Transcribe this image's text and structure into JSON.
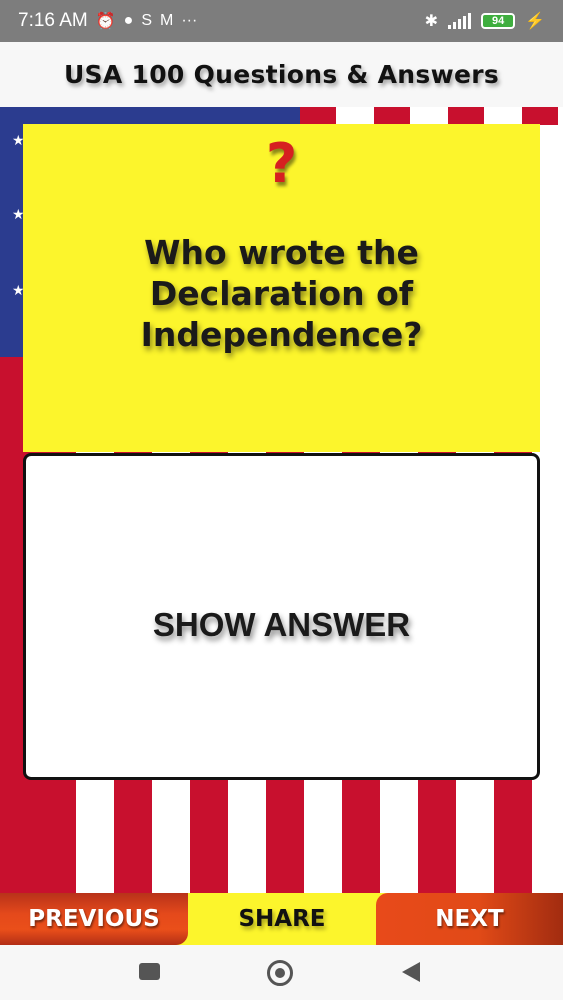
{
  "status_bar": {
    "time": "7:16 AM",
    "icons_left": [
      "alarm-icon",
      "chat-bubble-icon",
      "s-app-icon",
      "mail-icon",
      "more-dots-icon"
    ],
    "icons_right": [
      "bluetooth-icon",
      "signal-icon",
      "battery-icon",
      "charging-icon"
    ],
    "battery": "94",
    "more": "···"
  },
  "header": {
    "title": "USA 100 Questions & Answers"
  },
  "question": {
    "icon": "?",
    "text": "Who wrote the Declaration of Independence?"
  },
  "answer": {
    "label": "SHOW ANSWER"
  },
  "buttons": {
    "previous": "PREVIOUS",
    "share": "SHARE",
    "next": "NEXT"
  },
  "colors": {
    "status_bar": "#7d7d7d",
    "question_bg": "#fcf52c",
    "flag_red": "#c8102e",
    "flag_blue": "#2b3c8f",
    "button_orange": "#e84a1a"
  }
}
